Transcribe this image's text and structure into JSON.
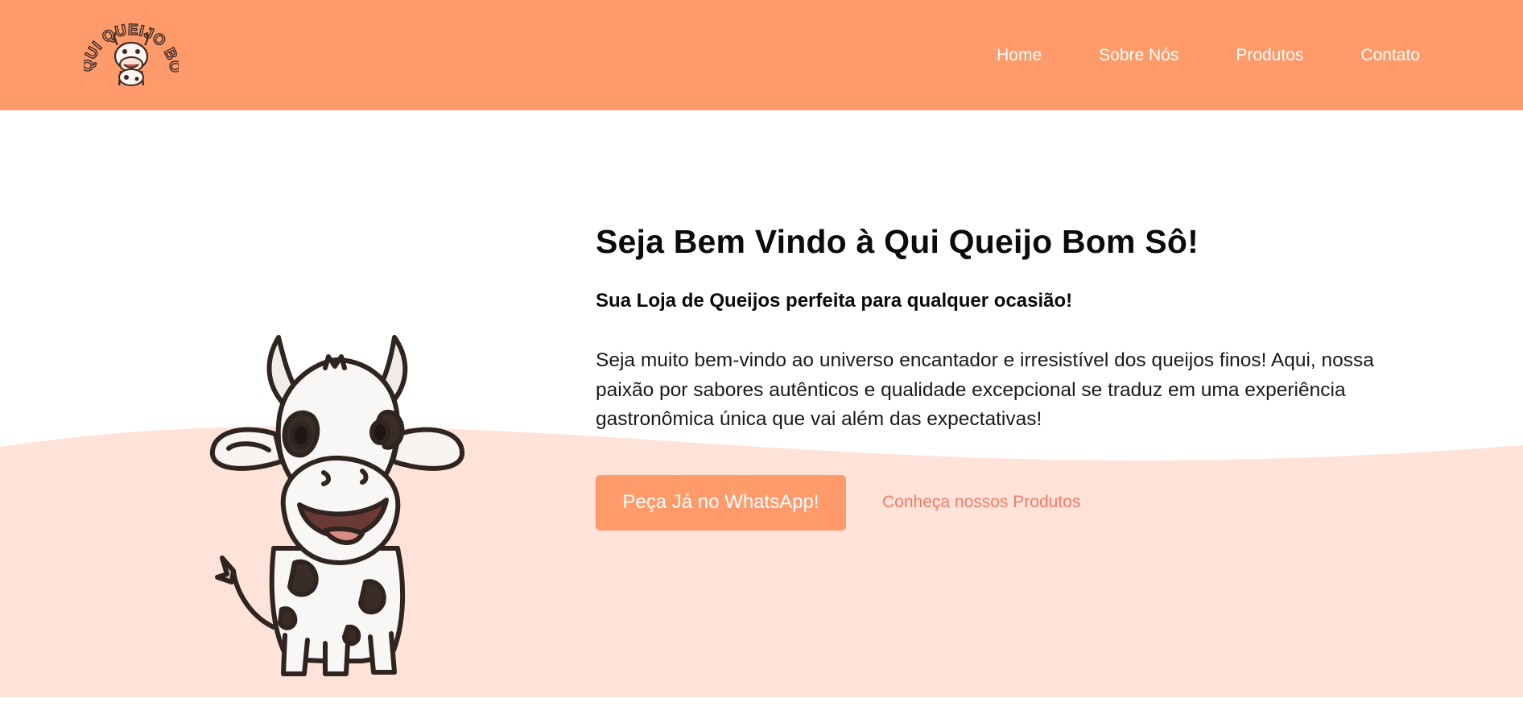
{
  "header": {
    "logo_text": "QUI QUEIJO BOM SÔ",
    "nav": [
      {
        "label": "Home"
      },
      {
        "label": "Sobre Nós"
      },
      {
        "label": "Produtos"
      },
      {
        "label": "Contato"
      }
    ]
  },
  "hero": {
    "title": "Seja Bem Vindo à Qui Queijo Bom Sô!",
    "subtitle": "Sua Loja de Queijos perfeita para qualquer ocasião!",
    "description": "Seja muito bem-vindo ao universo encantador e irresistível dos queijos finos! Aqui, nossa paixão por sabores autênticos e qualidade excepcional se traduz em uma experiência gastronômica única que vai além das expectativas!",
    "primary_button": "Peça Já no WhatsApp!",
    "secondary_link": "Conheça nossos Produtos"
  },
  "colors": {
    "brand": "#ff9b6b",
    "wave": "#ffe3d8",
    "link": "#f47a66"
  }
}
